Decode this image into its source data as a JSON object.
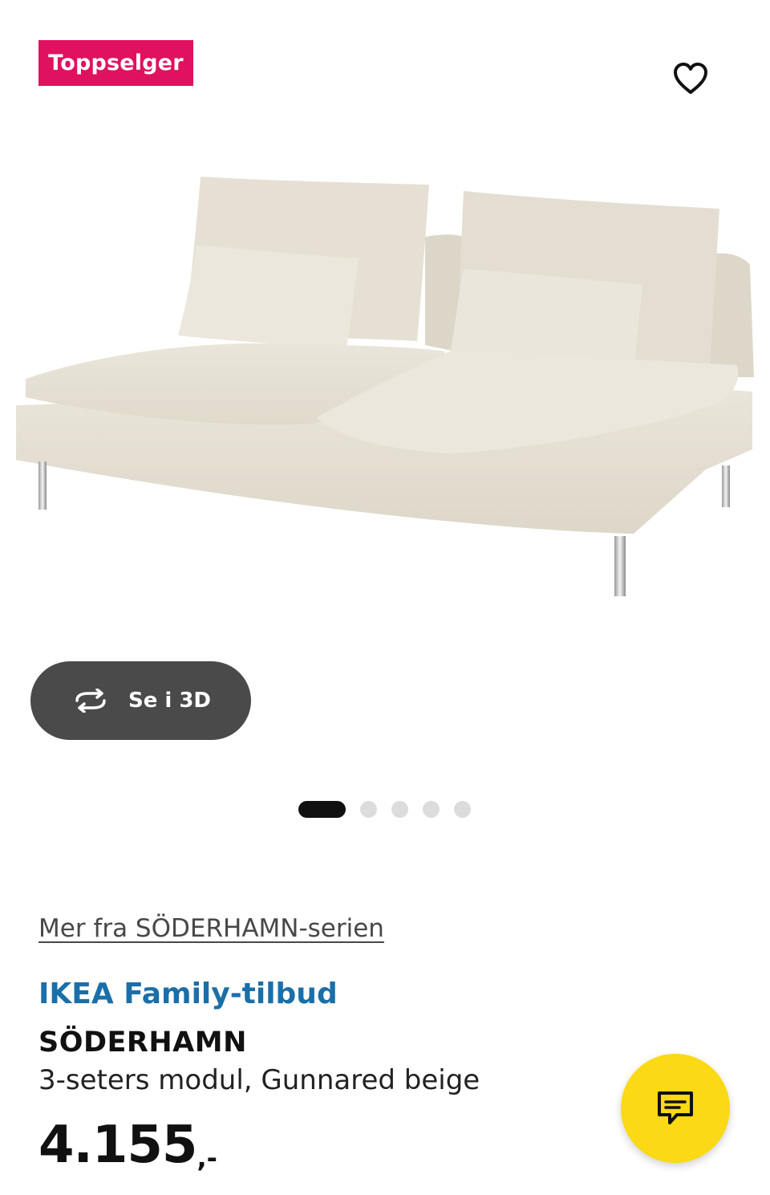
{
  "badge": {
    "label": "Toppselger",
    "color": "#e0115f"
  },
  "favorite": {
    "icon": "heart-outline-icon"
  },
  "product_image": {
    "subject": "sofa-module-image"
  },
  "view_3d": {
    "label": "Se i 3D",
    "icon": "rotate-3d-icon"
  },
  "carousel": {
    "total": 5,
    "active": 1
  },
  "series_link": {
    "label": "Mer fra SÖDERHAMN-serien"
  },
  "offer": {
    "label": "IKEA Family-tilbud",
    "color": "#1b6fa8"
  },
  "product": {
    "name": "SÖDERHAMN",
    "description": "3-seters modul, Gunnared beige",
    "price_main": "4.155",
    "price_suffix": ",-"
  },
  "chat": {
    "icon": "chat-icon",
    "color": "#fbd914"
  }
}
